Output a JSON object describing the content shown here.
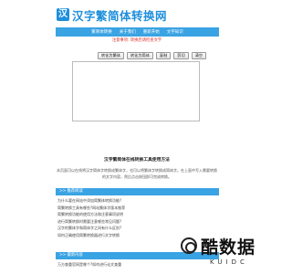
{
  "site": {
    "logo_mark": "汉",
    "logo_text": "汉字繁简体转换网",
    "brand_color": "#1e8fdc"
  },
  "nav": {
    "items": [
      {
        "label": "繁简体转换"
      },
      {
        "label": "关于我们"
      },
      {
        "label": "重新开始"
      },
      {
        "label": "文字知识"
      }
    ]
  },
  "notice": "注意事项: 转换后请检查文字",
  "toolbar": {
    "buttons": [
      {
        "label": "转化为繁体"
      },
      {
        "label": "转化为简体"
      },
      {
        "label": "复制"
      },
      {
        "label": "剪切"
      },
      {
        "label": "清空"
      }
    ]
  },
  "editor": {
    "value": ""
  },
  "article": {
    "title": "汉字繁简体在线转换工具使用方法",
    "body": "本页面可以在线将汉字简体字转换成繁体字，也可以将繁体字转换成简体字。在上面中写入需要转换的文字内容，然后点击按钮即可完成转换。"
  },
  "related": {
    "title": ">> 推荐阅读",
    "items": [
      {
        "text": "为什么要在网站中添加简繁体转换功能?"
      },
      {
        "text": "简繁转换工具有哪些?网站繁体字版本推荐"
      },
      {
        "text": "简繁转换功能的使用方法和注意事项说明"
      },
      {
        "text": "进行简繁转换时需要注意哪些常见问题?"
      },
      {
        "text": "汉字的繁体字和简体字之间有什么区别?"
      },
      {
        "text": "如何正确使用简繁转换器进行文字转换"
      }
    ]
  },
  "latest": {
    "title": ">> 最新内容",
    "items": [
      {
        "text": "万方查重官网是哪个?如何进行论文查重"
      }
    ]
  },
  "watermark": {
    "main": "酷数据",
    "sub": "KUIDC"
  }
}
